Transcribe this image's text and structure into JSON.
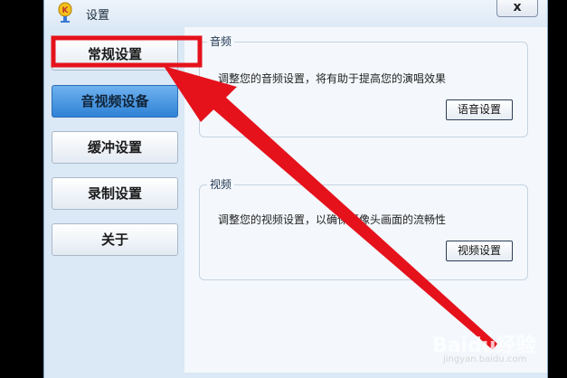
{
  "window": {
    "title": "设置",
    "close_label": "x",
    "app_icon": "microphone-k-icon"
  },
  "sidebar": {
    "items": [
      {
        "label": "常规设置",
        "state": "normal",
        "highlighted": true
      },
      {
        "label": "音视频设备",
        "state": "selected"
      },
      {
        "label": "缓冲设置",
        "state": "normal"
      },
      {
        "label": "录制设置",
        "state": "normal"
      },
      {
        "label": "关于",
        "state": "normal"
      }
    ]
  },
  "audio": {
    "legend": "音频",
    "description": "调整您的音频设置，将有助于提高您的演唱效果",
    "button": "语音设置"
  },
  "video": {
    "legend": "视频",
    "description": "调整您的视频设置，以确保摄像头画面的流畅性",
    "button": "视频设置"
  },
  "watermark": {
    "main": "Baidu经验",
    "sub": "jingyan.baidu.com"
  },
  "colors": {
    "annotation": "#e5121c",
    "selected_nav": "#3b8fe0",
    "panel_bg": "#f4f8fc"
  }
}
